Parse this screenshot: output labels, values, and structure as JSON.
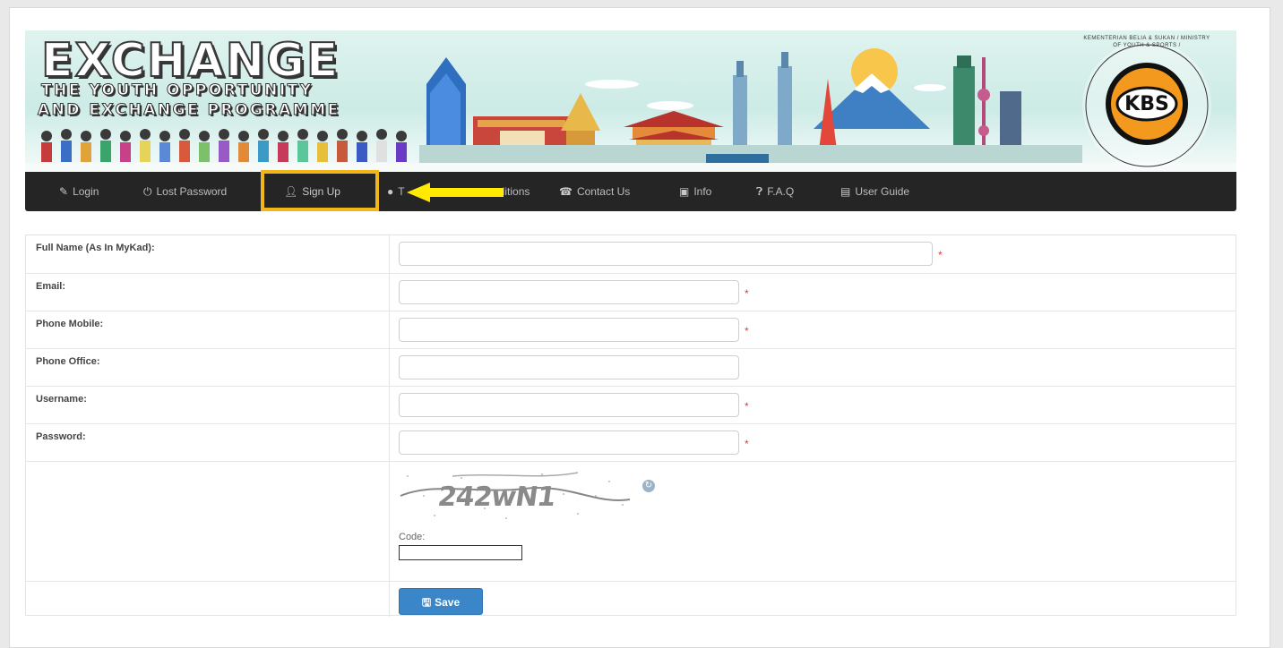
{
  "banner": {
    "title": "EXCHANGE",
    "subtitle_line1": "THE YOUTH OPPORTUNITY",
    "subtitle_line2": "AND EXCHANGE PROGRAMME",
    "logo_text": "KBS",
    "seal_text": "KEMENTERIAN BELIA & SUKAN / MINISTRY OF YOUTH & SPORTS /"
  },
  "nav": {
    "items": [
      {
        "label": "Login",
        "icon": "pencil-icon"
      },
      {
        "label": "Lost Password",
        "icon": "power-icon"
      },
      {
        "label": "Sign Up",
        "icon": "user-icon"
      },
      {
        "label": "T",
        "icon": "eye-icon"
      },
      {
        "label": "nditions",
        "icon": "none"
      },
      {
        "label": "Contact Us",
        "icon": "phone-icon"
      },
      {
        "label": "Info",
        "icon": "info-card-icon"
      },
      {
        "label": "F.A.Q",
        "icon": "question-icon"
      },
      {
        "label": "User Guide",
        "icon": "book-icon"
      }
    ],
    "highlight_color": "#f3b61a",
    "arrow_color": "#ffea00"
  },
  "form": {
    "fields": [
      {
        "label": "Full Name (As In MyKad):",
        "value": "",
        "required": "*"
      },
      {
        "label": "Email:",
        "value": "",
        "required": "*"
      },
      {
        "label": "Phone Mobile:",
        "value": "",
        "required": "*"
      },
      {
        "label": "Phone Office:",
        "value": "",
        "required": ""
      },
      {
        "label": "Username:",
        "value": "",
        "required": "*"
      },
      {
        "label": "Password:",
        "value": "",
        "required": "*"
      }
    ],
    "captcha_text": "242wN1",
    "code_label": "Code:",
    "code_value": "",
    "save_label": "Save"
  }
}
